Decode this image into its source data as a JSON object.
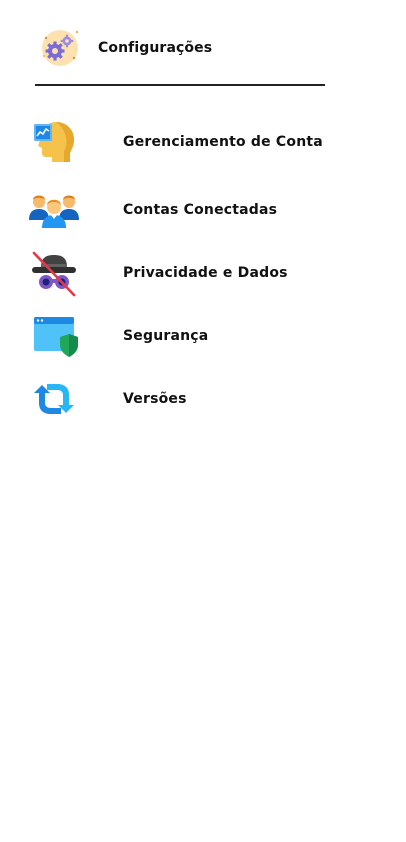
{
  "header": {
    "title": "Configurações",
    "icon": "settings-gears-icon"
  },
  "menu": {
    "items": [
      {
        "label": "Gerenciamento de Conta",
        "icon": "account-management-head-icon"
      },
      {
        "label": "Contas Conectadas",
        "icon": "connected-accounts-users-icon"
      },
      {
        "label": "Privacidade e Dados",
        "icon": "privacy-incognito-icon"
      },
      {
        "label": "Segurança",
        "icon": "security-shield-window-icon"
      },
      {
        "label": "Versões",
        "icon": "versions-refresh-icon"
      }
    ]
  },
  "colors": {
    "divider": "#222222",
    "text": "#111111",
    "accent_yellow": "#f5c24b",
    "accent_blue": "#1e88e5",
    "accent_green": "#21a65a",
    "accent_red": "#e53946"
  }
}
